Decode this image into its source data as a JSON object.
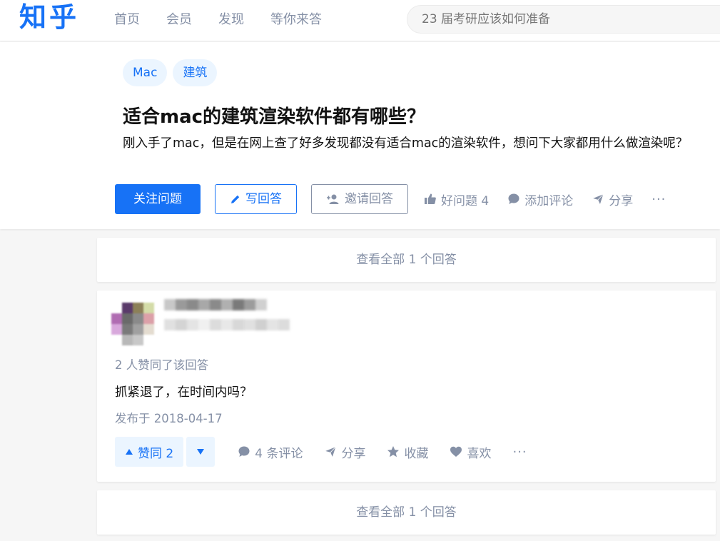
{
  "header": {
    "logo": "知乎",
    "nav": [
      {
        "label": "首页"
      },
      {
        "label": "会员"
      },
      {
        "label": "发现"
      },
      {
        "label": "等你来答"
      }
    ],
    "search_placeholder": "23 届考研应该如何准备"
  },
  "question": {
    "tags": [
      {
        "label": "Mac"
      },
      {
        "label": "建筑"
      }
    ],
    "title": "适合mac的建筑渲染软件都有哪些？",
    "detail": "刚入手了mac，但是在网上查了好多发现都没有适合mac的渲染软件，想问下大家都用什么做渲染呢？",
    "actions": {
      "follow": "关注问题",
      "write_answer": "写回答",
      "invite": "邀请回答",
      "good_question": "好问题 4",
      "add_comment": "添加评论",
      "share": "分享",
      "more": "···"
    }
  },
  "view_all_top": "查看全部 1 个回答",
  "answer": {
    "voters": "2 人赞同了该回答",
    "content": "抓紧退了，在时间内吗？",
    "date": "发布于 2018-04-17",
    "actions": {
      "upvote": "赞同 2",
      "comments": "4 条评论",
      "share": "分享",
      "collect": "收藏",
      "like": "喜欢",
      "more": "···"
    }
  },
  "view_all_bottom": "查看全部 1 个回答",
  "colors": {
    "brand_blue": "#1772f6",
    "muted_gray": "#8590a6",
    "tag_bg": "#ebf5ff",
    "page_bg": "#f6f6f6"
  }
}
